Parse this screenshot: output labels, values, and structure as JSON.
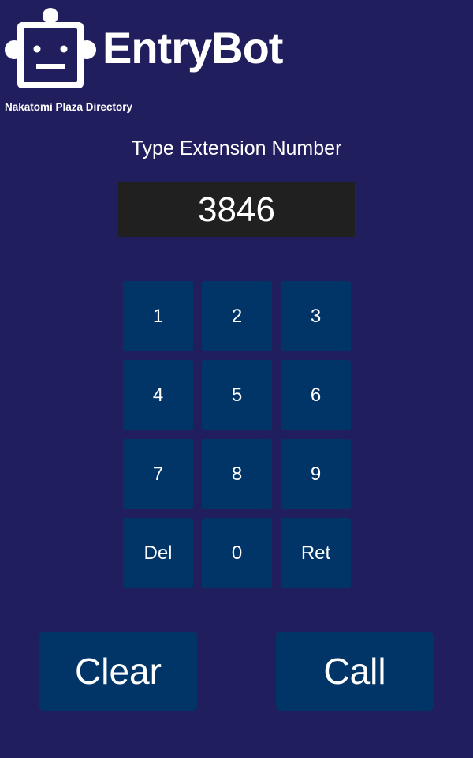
{
  "header": {
    "title": "EntryBot",
    "subtitle": "Nakatomi Plaza Directory",
    "logo_icon": "robot-face-icon"
  },
  "prompt": "Type Extension Number",
  "display": {
    "value": "3846"
  },
  "keypad": {
    "keys": [
      "1",
      "2",
      "3",
      "4",
      "5",
      "6",
      "7",
      "8",
      "9",
      "Del",
      "0",
      "Ret"
    ]
  },
  "actions": {
    "clear_label": "Clear",
    "call_label": "Call"
  },
  "colors": {
    "background": "#211e5e",
    "button": "#023567",
    "display_background": "#202020",
    "text": "#ffffff"
  }
}
